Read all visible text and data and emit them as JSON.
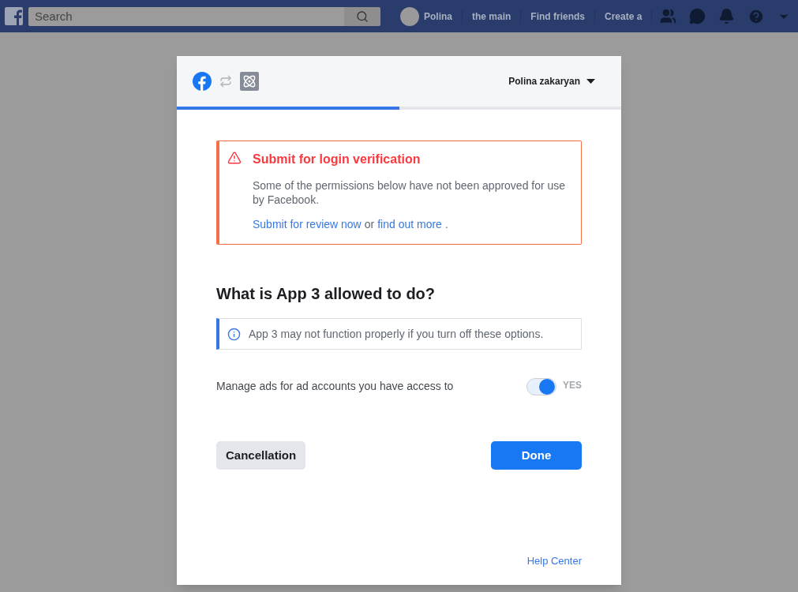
{
  "topbar": {
    "search": {
      "placeholder": "Search"
    },
    "profile": "Polina",
    "links": [
      "the main",
      "Find friends",
      "Create a"
    ]
  },
  "dialog": {
    "account": "Polina zakaryan",
    "progress": {
      "level": 0.5
    },
    "alert": {
      "title": "Submit for login verification",
      "body": "Some of the permissions below have not been approved for use by Facebook.",
      "link1": "Submit for review now",
      "middle": "or",
      "link2": "find out more",
      "end": "."
    },
    "heading": "What is App 3 allowed to do?",
    "info": "App 3 may not function properly if you turn off these options.",
    "permissions": [
      {
        "label": "Manage ads for ad accounts you have access to",
        "on": true,
        "state": "YES"
      }
    ],
    "buttons": {
      "cancel": "Cancellation",
      "done": "Done"
    },
    "help": "Help Center"
  }
}
